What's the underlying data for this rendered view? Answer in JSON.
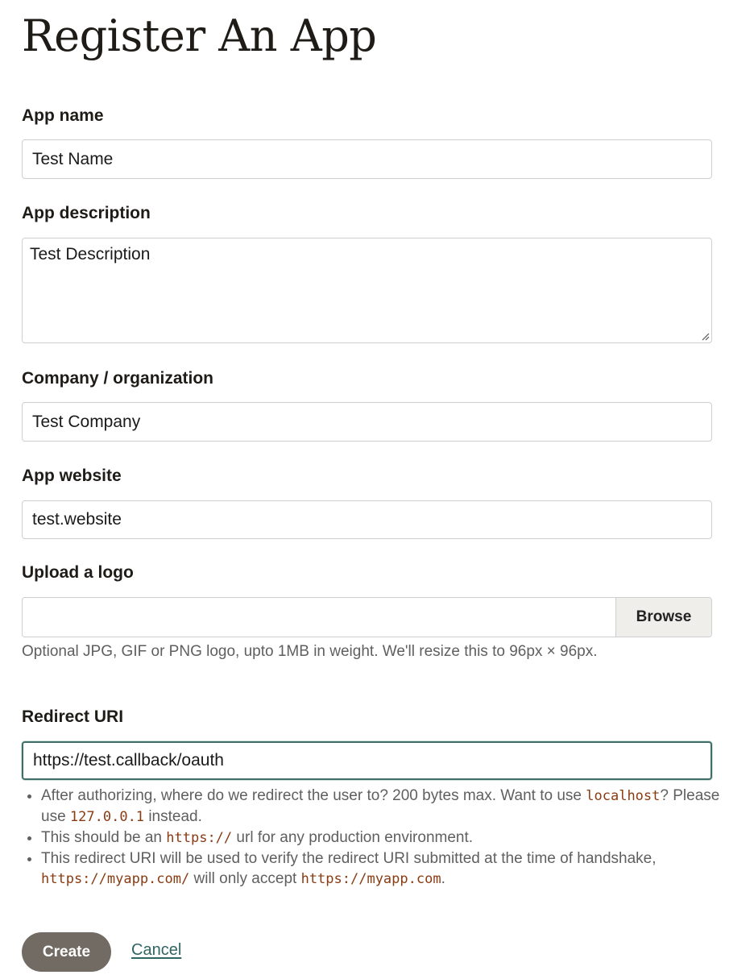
{
  "page": {
    "title": "Register An App"
  },
  "form": {
    "app_name": {
      "label": "App name",
      "value": "Test Name"
    },
    "app_description": {
      "label": "App description",
      "value": "Test Description"
    },
    "company": {
      "label": "Company / organization",
      "value": "Test Company"
    },
    "website": {
      "label": "App website",
      "value": "test.website"
    },
    "logo": {
      "label": "Upload a logo",
      "value": "",
      "browse_label": "Browse",
      "hint": "Optional JPG, GIF or PNG logo, upto 1MB in weight. We'll resize this to 96px × 96px."
    },
    "redirect_uri": {
      "label": "Redirect URI",
      "value": "https://test.callback/oauth",
      "notes": [
        {
          "t1": "After authorizing, where do we redirect the user to? 200 bytes max. Want to use ",
          "c1": "localhost",
          "t2": "? Please use ",
          "c2": "127.0.0.1",
          "t3": " instead."
        },
        {
          "t1": "This should be an ",
          "c1": "https://",
          "t2": " url for any production environment."
        },
        {
          "t1": "This redirect URI will be used to verify the redirect URI submitted at the time of handshake, ",
          "c1": "https://myapp.com/",
          "t2": " will only accept ",
          "c2": "https://myapp.com",
          "t3": "."
        }
      ]
    }
  },
  "actions": {
    "create_label": "Create",
    "cancel_label": "Cancel"
  },
  "colors": {
    "focus_border": "#3e6d6a",
    "create_button": "#726b63",
    "cancel_link": "#2f6563",
    "code_text": "#8a3b12"
  }
}
